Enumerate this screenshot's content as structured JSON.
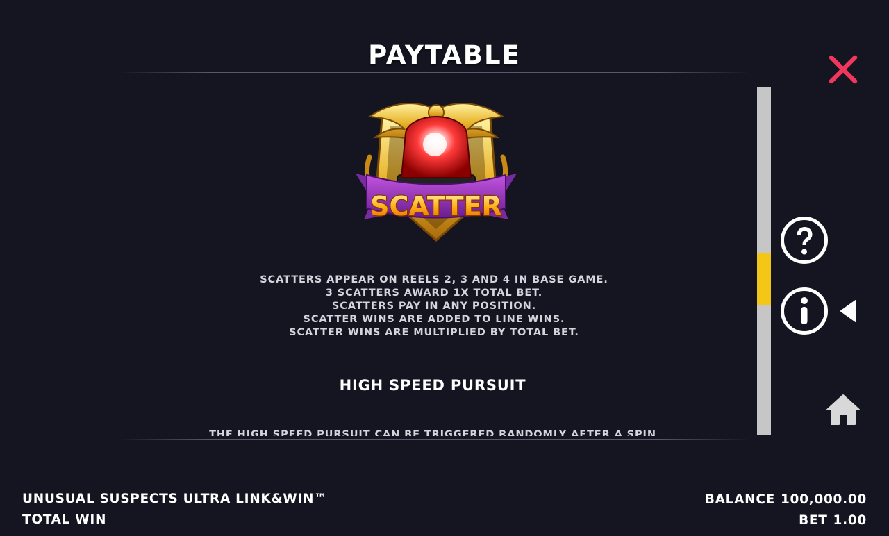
{
  "header": {
    "title": "PAYTABLE"
  },
  "symbol": {
    "name": "SCATTER",
    "icon": "scatter-siren-icon"
  },
  "scatter_rules": [
    "SCATTERS APPEAR ON REELS 2, 3 AND 4 IN BASE GAME.",
    "3 SCATTERS AWARD 1X TOTAL BET.",
    "SCATTERS PAY IN ANY POSITION.",
    "SCATTER WINS ARE ADDED TO LINE WINS.",
    "SCATTER WINS ARE MULTIPLIED BY TOTAL BET."
  ],
  "section": {
    "title": "HIGH SPEED PURSUIT",
    "partial_text": "THE HIGH SPEED PURSUIT CAN BE TRIGGERED RANDOMLY AFTER A SPIN"
  },
  "scrollbar": {
    "position": 0.56
  },
  "side_menu": {
    "icons": [
      "close-icon",
      "help-icon",
      "info-icon",
      "active-arrow-icon",
      "home-icon"
    ],
    "active": "info"
  },
  "footer": {
    "game_name": "UNUSUAL SUSPECTS ULTRA LINK&WIN™",
    "total_win_label": "TOTAL WIN",
    "balance_label": "BALANCE",
    "balance_value": "100,000.00",
    "bet_label": "BET",
    "bet_value": "1.00"
  },
  "colors": {
    "background": "#151521",
    "close": "#f0385c",
    "scroll_thumb": "#f3c718",
    "scroll_track": "#c6c6c6"
  }
}
